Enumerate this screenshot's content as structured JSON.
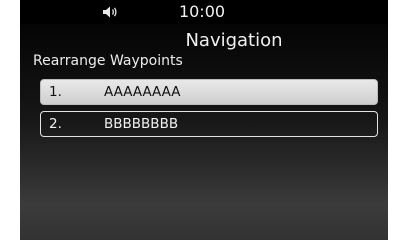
{
  "status_bar": {
    "time": "10:00",
    "volume_icon": "speaker-volume-icon"
  },
  "header": {
    "title": "Navigation",
    "subtitle": "Rearrange Waypoints"
  },
  "waypoints": [
    {
      "index": "1.",
      "name": "AAAAAAAA",
      "selected": true
    },
    {
      "index": "2.",
      "name": "BBBBBBBB",
      "selected": false
    }
  ],
  "colors": {
    "background_top": "#000000",
    "background_bottom": "#3b3b3b",
    "text": "#f0f0f0",
    "selected_row": "#dcdcdc"
  }
}
